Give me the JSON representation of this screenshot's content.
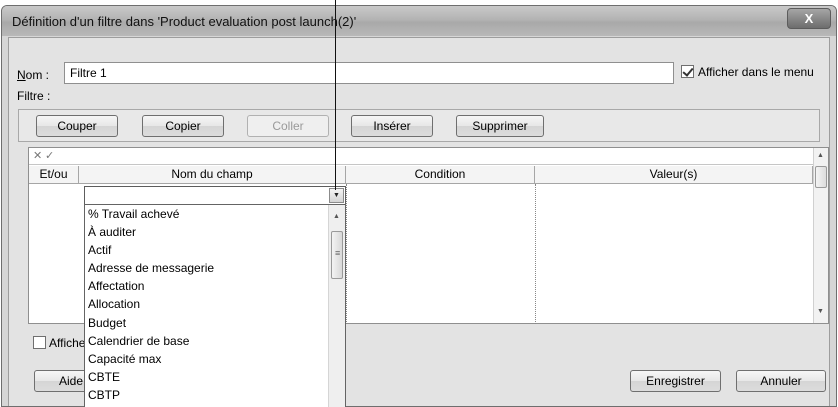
{
  "window": {
    "title": "Définition d'un filtre dans 'Product evaluation post launch(2)'",
    "close_glyph": "X"
  },
  "form": {
    "name_label": "Nom :",
    "name_value": "Filtre 1",
    "show_in_menu_label": "Afficher dans le menu",
    "show_in_menu_checked": true,
    "filter_label": "Filtre :"
  },
  "toolbar": {
    "cut": "Couper",
    "copy": "Copier",
    "paste": "Coller",
    "insert": "Insérer",
    "delete": "Supprimer"
  },
  "grid": {
    "cancel_glyph": "✕",
    "accept_glyph": "✓",
    "columns": [
      "Et/ou",
      "Nom du champ",
      "Condition",
      "Valeur(s)"
    ],
    "field_value": ""
  },
  "field_list": {
    "items": [
      "% Travail achevé",
      "À auditer",
      "Actif",
      "Adresse de messagerie",
      "Affectation",
      "Allocation",
      "Budget",
      "Calendrier de base",
      "Capacité max",
      "CBTE",
      "CBTP"
    ]
  },
  "footer": {
    "show_related_label_visible": "Affiche",
    "help_visible": "Aide",
    "save": "Enregistrer",
    "cancel": "Annuler"
  }
}
